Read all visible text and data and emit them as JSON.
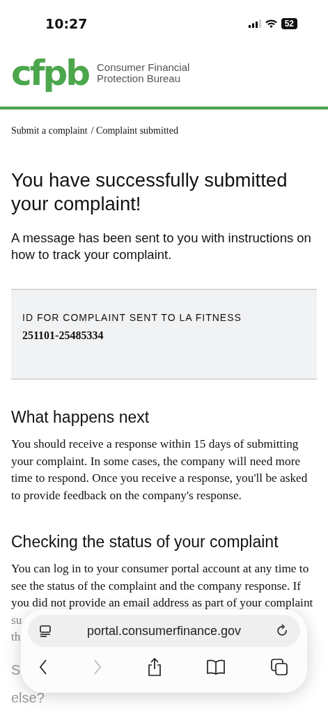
{
  "status_bar": {
    "time": "10:27",
    "battery": "52"
  },
  "header": {
    "logo": "cfpb",
    "agency": [
      "Consumer Financial",
      "Protection Bureau"
    ]
  },
  "breadcrumb": {
    "link": "Submit a complaint",
    "current": "/ Complaint submitted"
  },
  "title": "You have successfully submitted your complaint!",
  "intro": "A message has been sent to you with instructions on how to track your complaint.",
  "id_box": {
    "label": "ID FOR COMPLAINT SENT TO LA FITNESS",
    "value": "251101-25485334"
  },
  "sections": [
    {
      "heading": "What happens next",
      "body": "You should receive a response within 15 days of submitting your complaint. In some cases, the company will need more time to respond. Once you receive a response, you'll be asked to provide feedback on the company's response."
    },
    {
      "heading": "Checking the status of your complaint",
      "body": "You can log in to your consumer portal account at any time to see the status of the complaint and the company response. If you did not provide an email address as part of your complaint",
      "hidden_tail": [
        "su",
        "th"
      ]
    }
  ],
  "next_heading": [
    "S",
    "else?"
  ],
  "browser_bar": {
    "url": "portal.consumerfinance.gov"
  }
}
